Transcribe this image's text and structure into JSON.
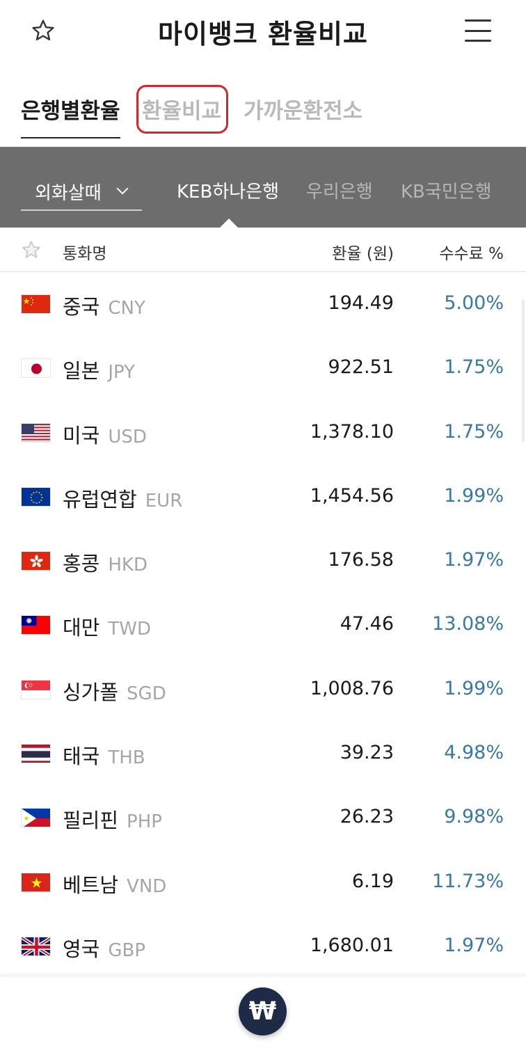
{
  "header": {
    "title": "마이뱅크 환율비교"
  },
  "tabs": [
    {
      "label": "은행별환율",
      "active": true
    },
    {
      "label": "환율비교",
      "active": false
    },
    {
      "label": "가까운환전소",
      "active": false
    }
  ],
  "bank_bar": {
    "select_value": "외화살때",
    "banks": [
      "KEB하나은행",
      "우리은행",
      "KB국민은행"
    ],
    "active_bank": "KEB하나은행"
  },
  "columns": {
    "name": "통화명",
    "rate": "환율 (원)",
    "fee": "수수료 %"
  },
  "rows": [
    {
      "country": "중국",
      "code": "CNY",
      "rate": "194.49",
      "fee": "5.00%",
      "flag": "cn"
    },
    {
      "country": "일본",
      "code": "JPY",
      "rate": "922.51",
      "fee": "1.75%",
      "flag": "jp"
    },
    {
      "country": "미국",
      "code": "USD",
      "rate": "1,378.10",
      "fee": "1.75%",
      "flag": "us"
    },
    {
      "country": "유럽연합",
      "code": "EUR",
      "rate": "1,454.56",
      "fee": "1.99%",
      "flag": "eu"
    },
    {
      "country": "홍콩",
      "code": "HKD",
      "rate": "176.58",
      "fee": "1.97%",
      "flag": "hk"
    },
    {
      "country": "대만",
      "code": "TWD",
      "rate": "47.46",
      "fee": "13.08%",
      "flag": "tw"
    },
    {
      "country": "싱가폴",
      "code": "SGD",
      "rate": "1,008.76",
      "fee": "1.99%",
      "flag": "sg"
    },
    {
      "country": "태국",
      "code": "THB",
      "rate": "39.23",
      "fee": "4.98%",
      "flag": "th"
    },
    {
      "country": "필리핀",
      "code": "PHP",
      "rate": "26.23",
      "fee": "9.98%",
      "flag": "ph"
    },
    {
      "country": "베트남",
      "code": "VND",
      "rate": "6.19",
      "fee": "11.73%",
      "flag": "vn"
    },
    {
      "country": "영국",
      "code": "GBP",
      "rate": "1,680.01",
      "fee": "1.97%",
      "flag": "gb"
    }
  ],
  "fab": {
    "symbol": "₩"
  },
  "colors": {
    "accent_blue": "#3779a4",
    "bar_gray": "#6d6d6d",
    "highlight_red": "#d4262b",
    "fab_navy": "#1f2a46"
  },
  "icons": {
    "favorite": "star-outline-icon",
    "menu": "hamburger-menu-icon",
    "dropdown": "chevron-down-icon"
  }
}
